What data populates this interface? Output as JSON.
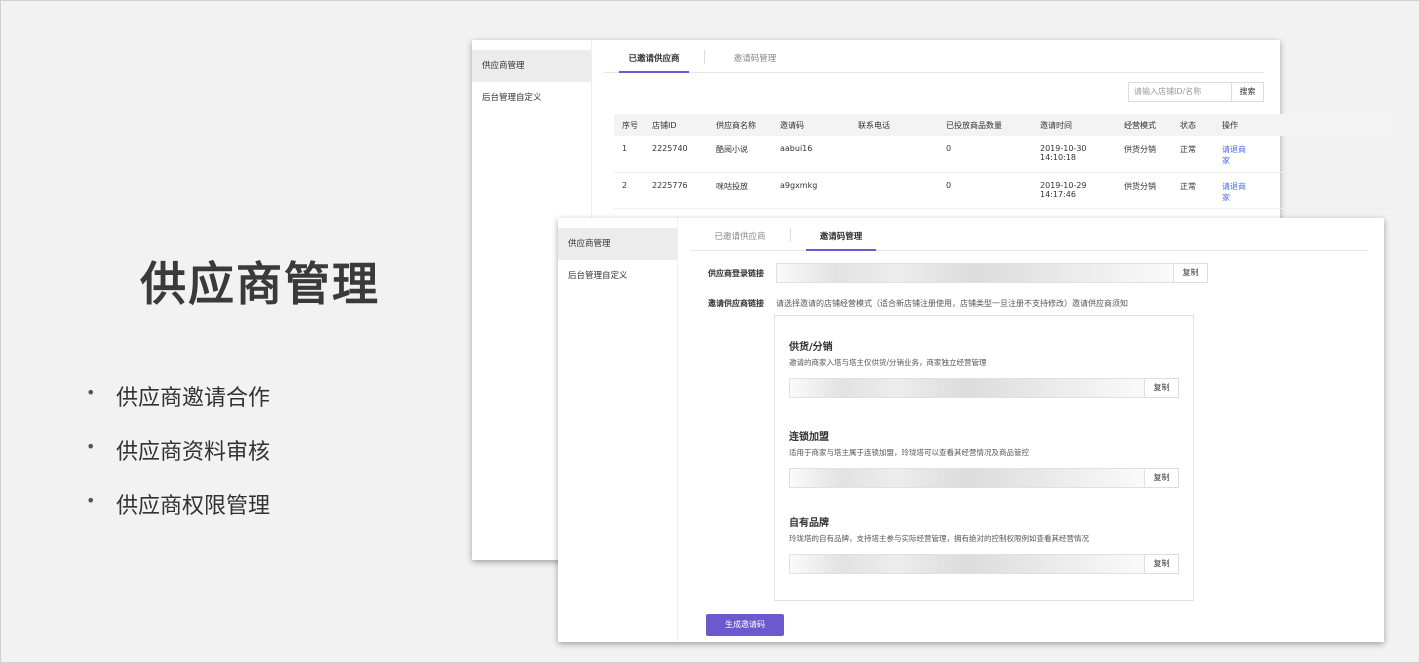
{
  "slide": {
    "title": "供应商管理",
    "bullets": [
      "供应商邀请合作",
      "供应商资料审核",
      "供应商权限管理"
    ]
  },
  "sidebar": {
    "items": [
      {
        "label": "供应商管理"
      },
      {
        "label": "后台管理自定义"
      }
    ]
  },
  "win1": {
    "tabs": [
      {
        "label": "已邀请供应商"
      },
      {
        "label": "邀请码管理"
      }
    ],
    "search": {
      "placeholder": "请输入店铺ID/名称",
      "button": "搜索"
    },
    "table": {
      "headers": [
        "序号",
        "店铺ID",
        "供应商名称",
        "邀请码",
        "联系电话",
        "已投放商品数量",
        "邀请时间",
        "经营模式",
        "状态",
        "操作"
      ],
      "rows": [
        {
          "idx": "1",
          "shop_id": "2225740",
          "name": "酷阅小说",
          "code": "aabui16",
          "phone": "",
          "count": "0",
          "date": "2019-10-30",
          "time": "14:10:18",
          "mode": "供货分销",
          "status": "正常",
          "action": "请退商家"
        },
        {
          "idx": "2",
          "shop_id": "2225776",
          "name": "咪咕投放",
          "code": "a9gxmkg",
          "phone": "",
          "count": "0",
          "date": "2019-10-29",
          "time": "14:17:46",
          "mode": "供货分销",
          "status": "正常",
          "action": "请退商家"
        }
      ]
    }
  },
  "win2": {
    "tabs": [
      {
        "label": "已邀请供应商"
      },
      {
        "label": "邀请码管理"
      }
    ],
    "login_link_label": "供应商登录链接",
    "invite_link_label": "邀请供应商链接",
    "invite_hint": "请选择邀请的店铺经营模式（适合新店铺注册使用，店铺类型一旦注册不支持修改）",
    "invite_hint_link": "邀请供应商须知",
    "copy_label": "复制",
    "modes": [
      {
        "title": "供货/分销",
        "desc": "邀请的商家入塔与塔主仅供货/分销业务，商家独立经营管理"
      },
      {
        "title": "连锁加盟",
        "desc": "适用于商家与塔主属于连锁加盟，玲珑塔可以查看其经营情况及商品管控"
      },
      {
        "title": "自有品牌",
        "desc": "玲珑塔的自有品牌，支持塔主参与实际经营管理，拥有绝对的控制权限例如查看其经营情况"
      }
    ],
    "generate_button": "生成邀请码"
  },
  "colors": {
    "accent": "#6a5acd",
    "link": "#4a6cf7",
    "background": "#f2f2f2"
  }
}
